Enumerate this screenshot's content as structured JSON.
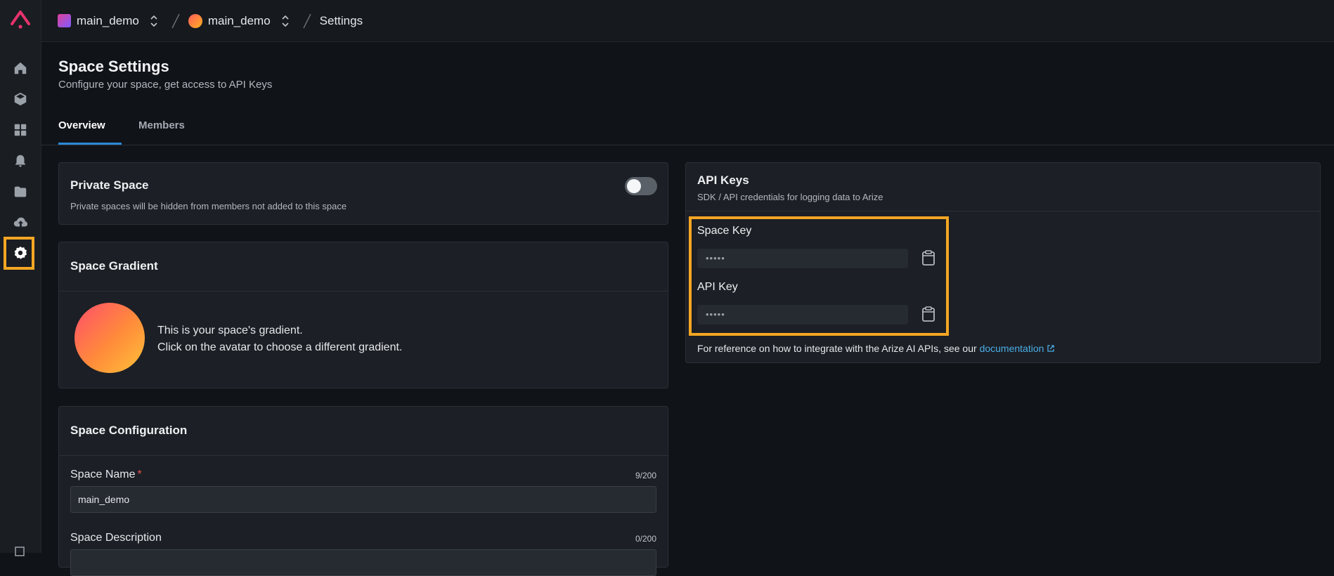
{
  "breadcrumbs": {
    "org": "main_demo",
    "space": "main_demo",
    "page": "Settings"
  },
  "header": {
    "title": "Space Settings",
    "subtitle": "Configure your space, get access to API Keys"
  },
  "tabs": [
    {
      "label": "Overview",
      "active": true
    },
    {
      "label": "Members",
      "active": false
    }
  ],
  "sidebar": {
    "items": [
      {
        "icon": "home-icon"
      },
      {
        "icon": "cube-icon"
      },
      {
        "icon": "dashboard-icon"
      },
      {
        "icon": "bell-icon"
      },
      {
        "icon": "folder-icon"
      },
      {
        "icon": "upload-cloud-icon"
      },
      {
        "icon": "settings-gear-icon",
        "active": true
      }
    ]
  },
  "private_space": {
    "title": "Private Space",
    "description": "Private spaces will be hidden from members not added to this space",
    "enabled": false
  },
  "space_gradient": {
    "title": "Space Gradient",
    "line1": "This is your space's gradient.",
    "line2": "Click on the avatar to choose a different gradient."
  },
  "space_config": {
    "title": "Space Configuration",
    "name_label": "Space Name",
    "name_required": "*",
    "name_counter": "9/200",
    "name_value": "main_demo",
    "desc_label": "Space Description",
    "desc_counter": "0/200"
  },
  "api_keys": {
    "title": "API Keys",
    "subtitle": "SDK / API credentials for logging data to Arize",
    "space_key_label": "Space Key",
    "space_key_value": "•••••",
    "api_key_label": "API Key",
    "api_key_value": "•••••",
    "reference_text": "For reference on how to integrate with the Arize AI APIs, see our",
    "doc_link": "documentation"
  },
  "colors": {
    "accent": "#2b8ad9",
    "highlight": "#f5a623",
    "link": "#4aaee8",
    "brand": "#e8336d"
  }
}
